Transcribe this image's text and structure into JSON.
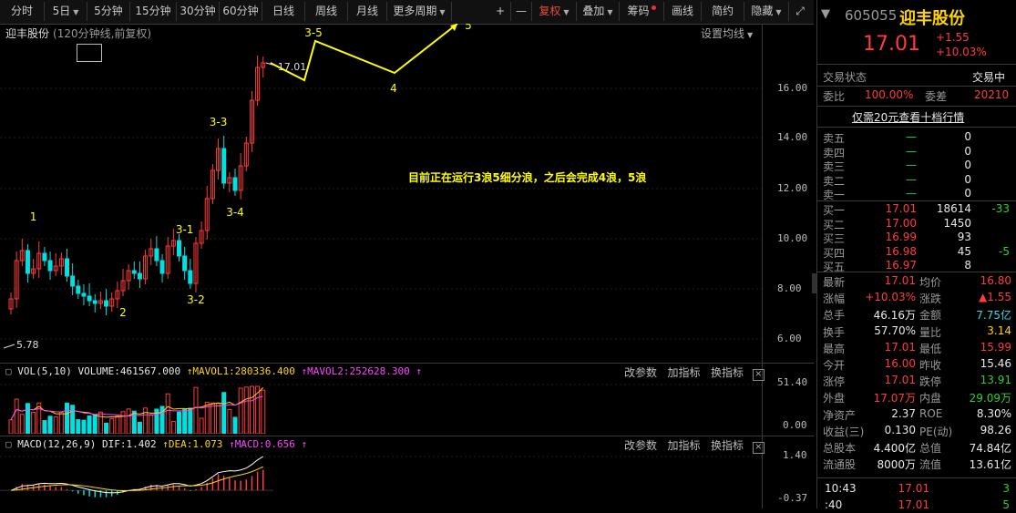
{
  "toolbar": {
    "periods": [
      "分时",
      "5日",
      "5分钟",
      "15分钟",
      "30分钟",
      "60分钟",
      "日线",
      "周线",
      "月线",
      "更多周期"
    ],
    "zoom_in": "+",
    "zoom_out": "—",
    "fuquan": "复权",
    "diejia": "叠加",
    "chouma": "筹码",
    "huaxian": "画线",
    "jianyue": "简约",
    "yincang": "隐藏",
    "expand": "⤢"
  },
  "main": {
    "title": "迎丰股份",
    "subtitle": "(120分钟线,前复权)",
    "ma_setting": "设置均线",
    "annotation": "目前正在运行3浪5细分浪，之后会完成4浪，5浪",
    "high_marker": "17.01",
    "low_marker": "5.78",
    "wave_labels": [
      "1",
      "2",
      "3-1",
      "3-2",
      "3-3",
      "3-4",
      "3-5",
      "4",
      "5"
    ],
    "y_ticks": [
      "16.00",
      "14.00",
      "12.00",
      "10.00",
      "8.00",
      "6.00"
    ]
  },
  "vol": {
    "head_name": "VOL(5,10)",
    "volume_label": "VOLUME:461567.000",
    "mavol1_label": "MAVOL1:280336.400",
    "mavol2_label": "MAVOL2:252628.300",
    "y_ticks": [
      "51.40",
      "0.00"
    ],
    "tool_params": "改参数",
    "tool_add": "加指标",
    "tool_switch": "换指标"
  },
  "macd": {
    "head_name": "MACD(12,26,9)",
    "dif_label": "DIF:1.402",
    "dea_label": "DEA:1.073",
    "macd_label": "MACD:0.656",
    "y_ticks": [
      "1.40",
      "-0.37"
    ],
    "tool_params": "改参数",
    "tool_add": "加指标",
    "tool_switch": "换指标"
  },
  "side": {
    "code": "605055",
    "name": "迎丰股份",
    "price": "17.01",
    "change": "+1.55",
    "change_pct": "+10.03%",
    "status_label": "交易状态",
    "status_value": "交易中",
    "weibi_label": "委比",
    "weibi_value": "100.00%",
    "weicha_label": "委差",
    "weicha_value": "20210",
    "promo": "仅需20元查看十档行情",
    "asks": [
      {
        "label": "卖五",
        "price": "—",
        "vol": "0"
      },
      {
        "label": "卖四",
        "price": "—",
        "vol": "0"
      },
      {
        "label": "卖三",
        "price": "—",
        "vol": "0"
      },
      {
        "label": "卖二",
        "price": "—",
        "vol": "0"
      },
      {
        "label": "卖一",
        "price": "—",
        "vol": "0"
      }
    ],
    "bids": [
      {
        "label": "买一",
        "price": "17.01",
        "vol": "18614",
        "delta": "-33"
      },
      {
        "label": "买二",
        "price": "17.00",
        "vol": "1450",
        "delta": ""
      },
      {
        "label": "买三",
        "price": "16.99",
        "vol": "93",
        "delta": ""
      },
      {
        "label": "买四",
        "price": "16.98",
        "vol": "45",
        "delta": "-5"
      },
      {
        "label": "买五",
        "price": "16.97",
        "vol": "8",
        "delta": ""
      }
    ],
    "stats": [
      {
        "l1": "最新",
        "v1": "17.01",
        "c1": "red",
        "l2": "均价",
        "v2": "16.80",
        "c2": "red"
      },
      {
        "l1": "涨幅",
        "v1": "+10.03%",
        "c1": "red",
        "l2": "涨跌",
        "v2": "▲1.55",
        "c2": "red"
      },
      {
        "l1": "总手",
        "v1": "46.16万",
        "c1": "white",
        "l2": "金额",
        "v2": "7.75亿",
        "c2": "cyan"
      },
      {
        "l1": "换手",
        "v1": "57.70%",
        "c1": "white",
        "l2": "量比",
        "v2": "3.14",
        "c2": "yellow"
      },
      {
        "l1": "最高",
        "v1": "17.01",
        "c1": "red",
        "l2": "最低",
        "v2": "15.99",
        "c2": "red"
      },
      {
        "l1": "今开",
        "v1": "16.00",
        "c1": "red",
        "l2": "昨收",
        "v2": "15.46",
        "c2": "white"
      },
      {
        "l1": "涨停",
        "v1": "17.01",
        "c1": "red",
        "l2": "跌停",
        "v2": "13.91",
        "c2": "green"
      },
      {
        "l1": "外盘",
        "v1": "17.07万",
        "c1": "red",
        "l2": "内盘",
        "v2": "29.09万",
        "c2": "green"
      },
      {
        "l1": "净资产",
        "v1": "2.37",
        "c1": "white",
        "l2": "ROE",
        "v2": "8.30%",
        "c2": "white"
      },
      {
        "l1": "收益(三)",
        "v1": "0.130",
        "c1": "white",
        "l2": "PE(动)",
        "v2": "98.26",
        "c2": "white"
      },
      {
        "l1": "总股本",
        "v1": "4.400亿",
        "c1": "white",
        "l2": "总值",
        "v2": "74.84亿",
        "c2": "white"
      },
      {
        "l1": "流通股",
        "v1": "8000万",
        "c1": "white",
        "l2": "流值",
        "v2": "13.61亿",
        "c2": "white"
      }
    ],
    "ticks": [
      {
        "time": "10:43",
        "price": "17.01",
        "vol": "3"
      },
      {
        "time": ":40",
        "price": "17.01",
        "vol": "5"
      }
    ]
  },
  "colors": {
    "up": "#ff3b3b",
    "down": "#00e0e0",
    "annotation": "#ffff00",
    "dif": "#ffffff",
    "dea": "#ffd400",
    "mavol2": "#ff44ff"
  },
  "chart_data": {
    "type": "candlestick",
    "title": "迎丰股份",
    "y_axis": {
      "ticks": [
        16,
        14,
        12,
        10,
        8,
        6
      ],
      "range": [
        5.4,
        18.2
      ]
    },
    "high": 17.01,
    "low": 5.78,
    "closes_approx": [
      7.6,
      9.1,
      9.5,
      8.6,
      8.8,
      9.4,
      9.1,
      8.7,
      8.9,
      9.2,
      8.5,
      8.1,
      7.8,
      7.7,
      7.5,
      7.4,
      7.5,
      7.3,
      7.6,
      7.9,
      8.3,
      8.7,
      8.6,
      8.4,
      9.3,
      9.6,
      9.1,
      8.6,
      9.7,
      9.9,
      9.3,
      8.7,
      8.2,
      9.8,
      10.3,
      11.6,
      12.7,
      13.6,
      12.2,
      12.4,
      11.9,
      12.9,
      13.8,
      15.5,
      16.8,
      17.01
    ],
    "volume_y_axis": {
      "ticks": [
        51.4,
        0
      ],
      "unit": "万"
    },
    "macd_y_axis": {
      "ticks": [
        1.4,
        -0.37
      ]
    }
  }
}
